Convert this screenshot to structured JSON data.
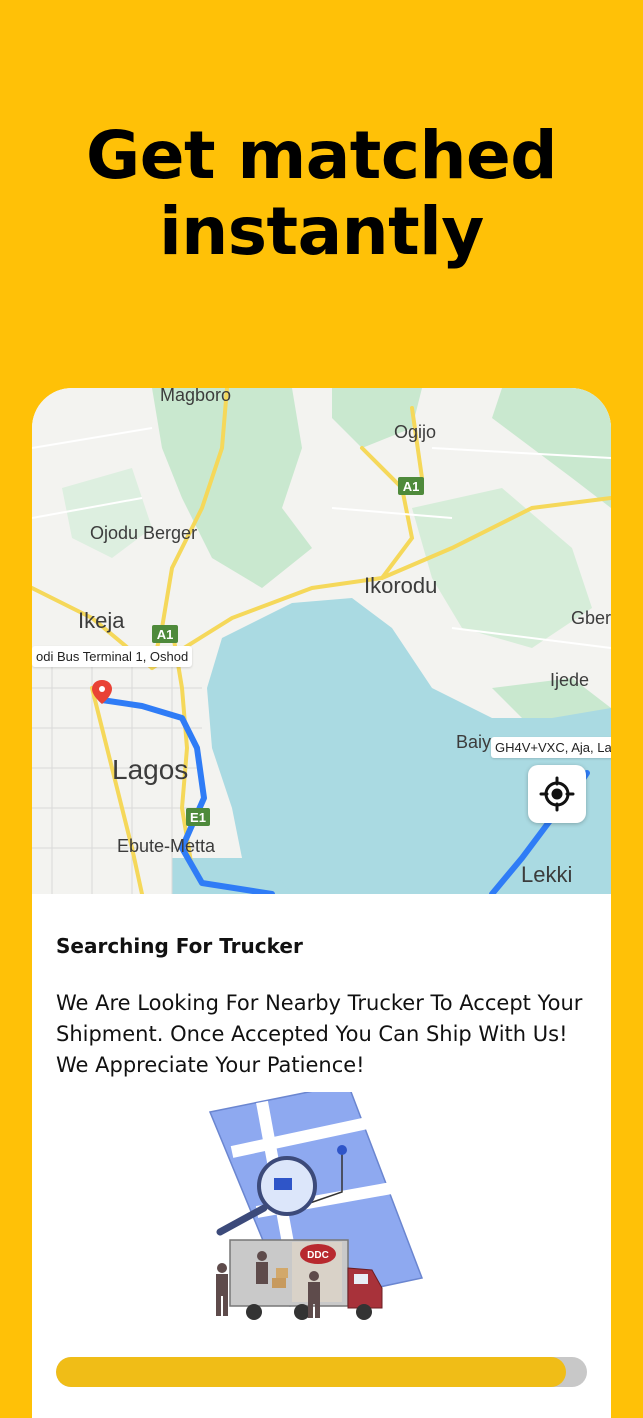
{
  "headline": {
    "line1": "Get matched",
    "line2": "instantly"
  },
  "map": {
    "places": {
      "magboro": "Magboro",
      "ogijo": "Ogijo",
      "ojodu": "Ojodu Berger",
      "ikorodu": "Ikorodu",
      "gber": "Gber",
      "ikeja": "Ikeja",
      "ijede": "Ijede",
      "baiy": "Baiy",
      "lagos": "Lagos",
      "ebute": "Ebute-Metta",
      "lekki": "Lekki"
    },
    "shields": {
      "a1_top": "A1",
      "a1_left": "A1",
      "e1": "E1"
    },
    "pickup_chip": "odi Bus Terminal 1, Oshod",
    "dropoff_chip": "GH4V+VXC, Aja, La",
    "locate_icon": "my-location-icon"
  },
  "sheet": {
    "title": "Searching For Trucker",
    "message": "We Are Looking For Nearby Trucker To Accept Your Shipment. Once Accepted You Can Ship With Us! We Appreciate Your Patience!",
    "truck_logo": "DDC",
    "progress": 0.96
  },
  "colors": {
    "brand": "#FFC107",
    "route": "#2F7CF6",
    "progress": "#F0BD17"
  }
}
